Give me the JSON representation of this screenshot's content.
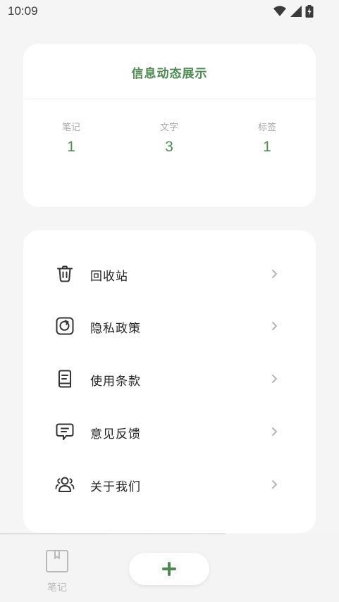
{
  "status_bar": {
    "time": "10:09"
  },
  "stats": {
    "title": "信息动态展示",
    "items": [
      {
        "label": "笔记",
        "value": "1"
      },
      {
        "label": "文字",
        "value": "3"
      },
      {
        "label": "标签",
        "value": "1"
      }
    ]
  },
  "menu": {
    "items": [
      {
        "label": "回收站",
        "icon": "trash-icon"
      },
      {
        "label": "隐私政策",
        "icon": "privacy-icon"
      },
      {
        "label": "使用条款",
        "icon": "document-icon"
      },
      {
        "label": "意见反馈",
        "icon": "feedback-icon"
      },
      {
        "label": "关于我们",
        "icon": "users-icon"
      }
    ]
  },
  "bottom_nav": {
    "notes_label": "笔记",
    "notes_icon": "notebook-icon",
    "add_icon": "plus-icon"
  },
  "colors": {
    "accent": "#4f8a52",
    "background": "#f5f5f5",
    "card": "#ffffff"
  }
}
